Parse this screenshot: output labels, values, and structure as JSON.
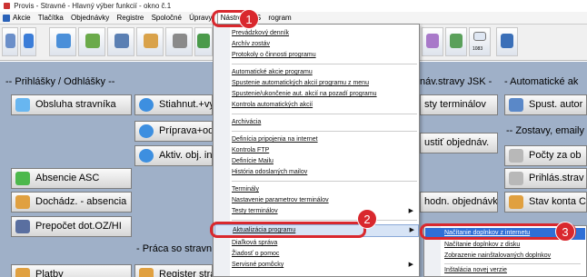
{
  "window": {
    "title": "Provis - Stravné - Hlavný výber funkcií - okno č.1"
  },
  "menubar": {
    "items": [
      "Akcie",
      "Tlačítka",
      "Objednávky",
      "Registre",
      "Spoločné",
      "Úpravy",
      "Nástroje",
      "S",
      "rogram"
    ]
  },
  "toolbar": {
    "badge_label": "1083"
  },
  "sections": {
    "prihlasky": "-- Prihlášky / Odhlášky --",
    "prace": "- Práca so stravn",
    "nav_jsk": "náv.stravy JSK -",
    "auto": "- Automatické ak",
    "zostavy": "-- Zostavy, emaily"
  },
  "buttons": {
    "obsluha": "Obsluha stravníka",
    "stiahnut": "Stiahnut.+vyh",
    "priprava": "Príprava+od",
    "aktiv": "Aktiv. obj. int",
    "absencie": "Absencie ASC",
    "dochadz": "Dochádz. - absencia",
    "prepocet": "Prepočet dot.OZ/HI",
    "platby": "Platby",
    "register": "Register stra",
    "terminalov": "sty terminálov",
    "spustit_obj": "ustiť objednáv.",
    "schval": "hodn. objednávky",
    "spust_auto": "Spust. autor",
    "pocty": "Počty za ob",
    "prihlas_strav": "Prihlás.strav",
    "stav_konta": "Stav konta C",
    "stat": "st"
  },
  "nastroje_menu": {
    "items": [
      "Prevádzkový denník",
      "Archív zostáv",
      "Protokoly o činnosti programu",
      "Automatické akcie programu",
      "Spustenie automatických akcií programu z menu",
      "Spustenie/ukončenie aut. akcií na pozadí programu",
      "Kontrola automatických akcií",
      "Archivácia",
      "Definícia pripojenia na internet",
      "Kontrola FTP",
      "Definície Mailu",
      "História odoslaných mailov",
      "Terminály",
      "Nastavenie parametrov terminálov",
      "Testy terminálov",
      "Aktualizácia programu",
      "Diaľková správa",
      "Žiadosť o pomoc",
      "Servisné pomôcky"
    ]
  },
  "submenu": {
    "items": [
      "Načítanie doplnkov z internetu",
      "Načítanie doplnkov z disku",
      "Zobrazenie nainštalovaných doplnkov",
      "Inštalácia novej verzie"
    ]
  },
  "callouts": [
    "1",
    "2",
    "3"
  ],
  "colors": {
    "accent": "#d9282e",
    "menu_highlight": "#2f6fd6",
    "workspace": "#9fb0c8"
  }
}
